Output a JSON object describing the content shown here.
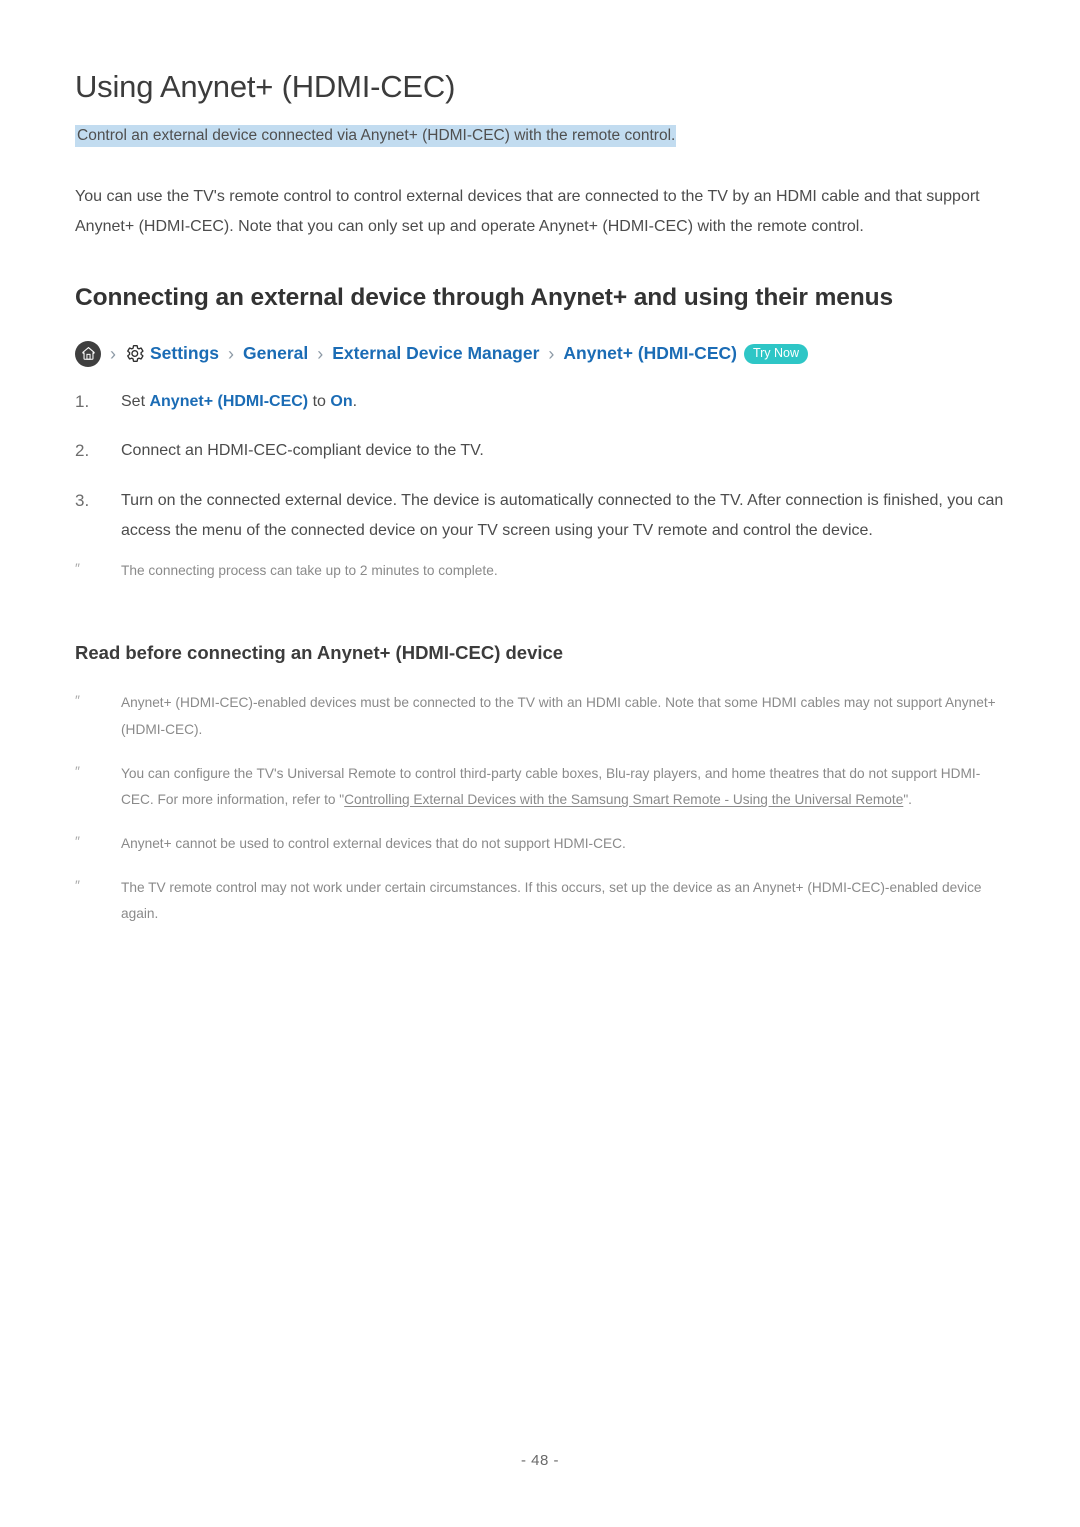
{
  "document": {
    "title": "Using Anynet+ (HDMI-CEC)",
    "subtitle": "Control an external device connected via Anynet+ (HDMI-CEC) with the remote control.",
    "intro_paragraph": "You can use the TV's remote control to control external devices that are connected to the TV by an HDMI cable and that support Anynet+ (HDMI-CEC). Note that you can only set up and operate Anynet+ (HDMI-CEC) with the remote control.",
    "page_number": "- 48 -"
  },
  "section": {
    "heading": "Connecting an external device through Anynet+ and using their menus",
    "breadcrumb": {
      "home_icon": "home-icon",
      "gear_icon": "gear-icon",
      "separator": "›",
      "items": [
        {
          "label": "Settings"
        },
        {
          "label": "General"
        },
        {
          "label": "External Device Manager"
        },
        {
          "label": "Anynet+ (HDMI-CEC)"
        }
      ],
      "badge": "Try Now",
      "badge_color": "#2ec6c6",
      "link_color": "#1b6cb5"
    },
    "steps": [
      {
        "number": "1.",
        "prefix": "Set ",
        "keyword1": "Anynet+ (HDMI-CEC)",
        "middle": " to ",
        "keyword2": "On",
        "suffix": "."
      },
      {
        "number": "2.",
        "text": "Connect an HDMI-CEC-compliant device to the TV."
      },
      {
        "number": "3.",
        "text": "Turn on the connected external device. The device is automatically connected to the TV. After connection is finished, you can access the menu of the connected device on your TV screen using your TV remote and control the device."
      }
    ],
    "step_note": {
      "mark": "″",
      "text": "The connecting process can take up to 2 minutes to complete."
    }
  },
  "subsection": {
    "heading": "Read before connecting an Anynet+ (HDMI-CEC) device",
    "bullet_mark": "″",
    "notes": [
      {
        "text": "Anynet+ (HDMI-CEC)-enabled devices must be connected to the TV with an HDMI cable. Note that some HDMI cables may not support Anynet+ (HDMI-CEC)."
      },
      {
        "text_before": "You can configure the TV's Universal Remote to control third-party cable boxes, Blu-ray players, and home theatres that do not support HDMI-CEC. For more information, refer to \"",
        "link_text": "Controlling External Devices with the Samsung Smart Remote - Using the Universal Remote",
        "text_after": "\"."
      },
      {
        "text": "Anynet+ cannot be used to control external devices that do not support HDMI-CEC."
      },
      {
        "text": "The TV remote control may not work under certain circumstances. If this occurs, set up the device as an Anynet+ (HDMI-CEC)-enabled device again."
      }
    ]
  }
}
